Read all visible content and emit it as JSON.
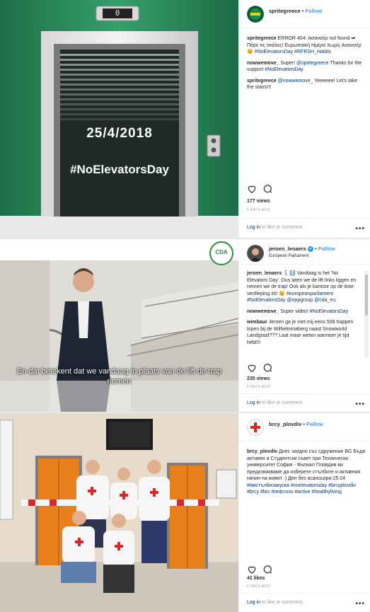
{
  "posts": [
    {
      "username": "spritegreece",
      "follow_label": "Follow",
      "image": {
        "floor_display": "0",
        "date_text": "25/4/2018",
        "hashtag_text": "#NoElevatorsDay"
      },
      "comments": [
        {
          "user": "spritegreece",
          "text": "ERROR 404: Ασανσέρ not found ➡ Πάρε τις σκάλες! Ευρωπαϊκή Ημέρα Χωρίς Ασανσέρ 😉",
          "tags": [
            "#NoElevatorsDay",
            "#RFRSH_Habits"
          ]
        },
        {
          "user": "nowwemove_",
          "text": "Super!",
          "mention": "@spritegreece",
          "text2": "Thanks for the support",
          "tags": [
            "#NoElevatorsDay"
          ]
        },
        {
          "user": "spritegreece",
          "mention": "@nowwemove_",
          "text": "Yeeeeee! Let's take the stairs!!!"
        }
      ],
      "count_text": "177 views",
      "time_ago": "6 DAYS AGO",
      "login_link": "Log in",
      "login_rest": "to like or comment."
    },
    {
      "username": "jeroen_lenaers",
      "follow_label": "Follow",
      "location": "European Parliament",
      "image": {
        "logo_text": "CDA",
        "subtitle": "En dat betekent dat we vandaag in plaats van de lift de trap nemen"
      },
      "comments": [
        {
          "user": "jeroen_lenaers",
          "text": "🚶‍♂️🔝 Vandaag is het 'No Elevators Day'. Dus laten we de lift links liggen en nemen we de trap! Ook als je kantoor op de 8ste verdieping zit! 😉",
          "tags": [
            "#europeanparliament",
            "#NoElevatorsDay"
          ],
          "mentions": [
            "@eppgroup",
            "@cda_eu"
          ]
        },
        {
          "user": "nowwemove_",
          "text": "Super video!",
          "tags": [
            "#NoElevatorsDay"
          ]
        },
        {
          "user": "wimbaur",
          "text": "Jeroen ga je met mij eens 508 trappen lopen bij de Wilhelminaberg naast Snowworld Landgraaf??? Laat maar weten wanneer je tijd hebt!!!"
        }
      ],
      "count_text": "235 views",
      "time_ago": "6 DAYS AGO",
      "login_link": "Log in",
      "login_rest": "to like or comment."
    },
    {
      "username": "brcy_plovdiv",
      "follow_label": "Follow",
      "comments": [
        {
          "user": "brcy_plovdiv",
          "text": "Днес заедно със сдружение BG Бъди активен и Студентски съвет при Технически университет София - Филиал Пловдив ви предизвикваме да изберете стълбите и активния начин на живот :) Ден без асансьори-25.04",
          "tags": [
            "#ямстълбизакуска",
            "#noelevatorsday",
            "#brcyplovdiv",
            "#brcy",
            "#brc",
            "#redcross",
            "#active",
            "#healthyliving"
          ]
        }
      ],
      "count_text": "41 likes",
      "time_ago": "5 DAYS AGO",
      "login_link": "Log in",
      "login_rest": "to like or comment."
    }
  ],
  "colors": {
    "link": "#003569",
    "follow": "#3897f0",
    "muted": "#999999",
    "elevator_green": "#2f8f5e"
  }
}
